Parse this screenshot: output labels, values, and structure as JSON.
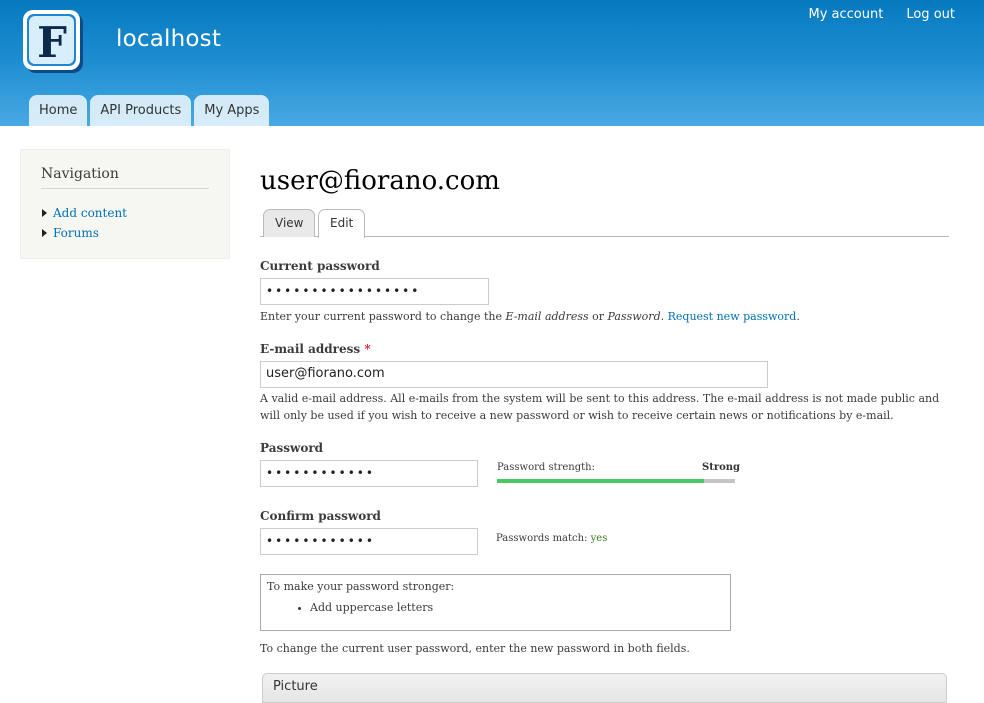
{
  "site": {
    "name": "localhost",
    "logo_letter": "F"
  },
  "secondary_menu": {
    "my_account": "My account",
    "logout": "Log out"
  },
  "main_menu": {
    "home": "Home",
    "api_products": "API Products",
    "my_apps": "My Apps"
  },
  "sidebar": {
    "title": "Navigation",
    "items": [
      {
        "label": "Add content"
      },
      {
        "label": "Forums"
      }
    ]
  },
  "page": {
    "title": "user@fiorano.com",
    "tabs": {
      "view": "View",
      "edit": "Edit"
    }
  },
  "form": {
    "current_password": {
      "label": "Current password",
      "value": "•••••••••••••••••",
      "desc_prefix": "Enter your current password to change the ",
      "desc_email": "E-mail address",
      "desc_or": " or ",
      "desc_password": "Password",
      "desc_dot": ". ",
      "desc_link": "Request new password",
      "desc_end": "."
    },
    "email": {
      "label": "E-mail address",
      "required_mark": "*",
      "value": "user@fiorano.com",
      "desc": "A valid e-mail address. All e-mails from the system will be sent to this address. The e-mail address is not made public and will only be used if you wish to receive a new password or wish to receive certain news or notifications by e-mail."
    },
    "password": {
      "label": "Password",
      "value": "••••••••••••",
      "strength_label": "Password strength:",
      "strength_value": "Strong",
      "strength_fraction": 0.87
    },
    "confirm_password": {
      "label": "Confirm password",
      "value": "••••••••••••",
      "match_label": "Passwords match: ",
      "match_value": "yes"
    },
    "suggestions": {
      "title": "To make your password stronger:",
      "items": [
        "Add uppercase letters"
      ]
    },
    "password_note": "To change the current user password, enter the new password in both fields.",
    "picture_legend": "Picture"
  },
  "colors": {
    "header_top": "#0779bf",
    "header_bottom": "#48a9e4",
    "link": "#0071b3",
    "strength_fill": "#47c965",
    "match_yes": "#3c7a1c",
    "required": "#e0252b"
  }
}
